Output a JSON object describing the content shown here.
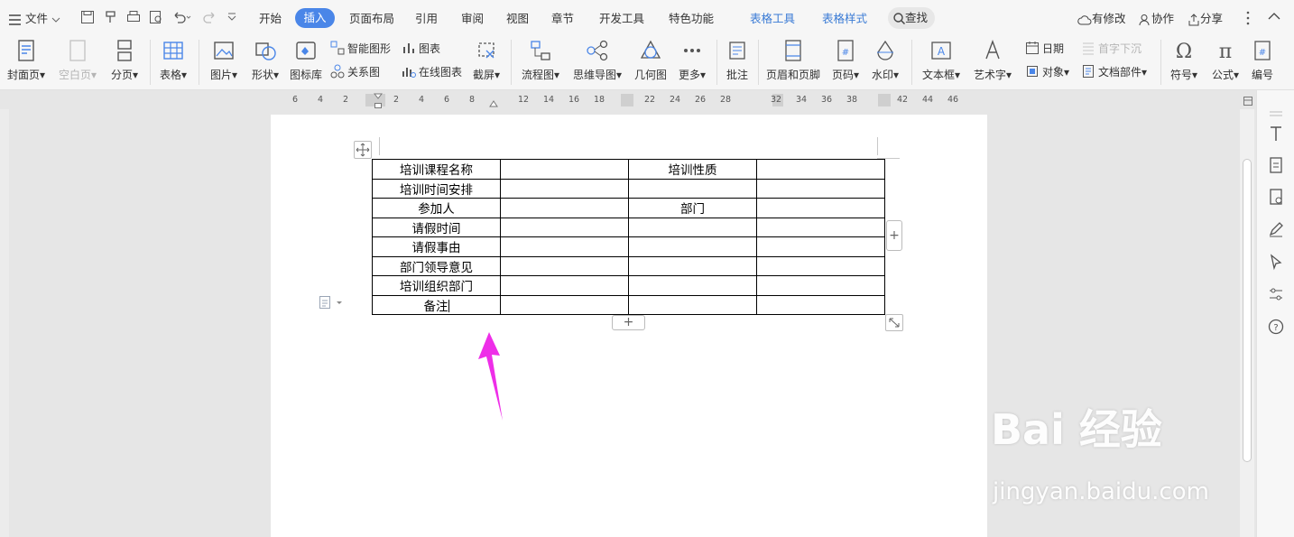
{
  "menubar": {
    "file_label": "文件",
    "tabs": [
      "开始",
      "插入",
      "页面布局",
      "引用",
      "审阅",
      "视图",
      "章节",
      "开发工具",
      "特色功能"
    ],
    "context_tabs": [
      "表格工具",
      "表格样式"
    ],
    "search_label": "查找",
    "right_items": [
      "有修改",
      "协作",
      "分享"
    ]
  },
  "ribbon": {
    "cover": "封面页",
    "blank": "空白页",
    "pagebreak": "分页",
    "table": "表格",
    "picture": "图片",
    "shape": "形状",
    "iconlib": "图标库",
    "smartart": "智能图形",
    "chart": "图表",
    "relation": "关系图",
    "onlinechart": "在线图表",
    "screenshot": "截屏",
    "flowchart": "流程图",
    "mindmap": "思维导图",
    "geometry": "几何图",
    "more": "更多",
    "comment": "批注",
    "headerfooter": "页眉和页脚",
    "pagenum": "页码",
    "watermark": "水印",
    "textbox": "文本框",
    "wordart": "艺术字",
    "date": "日期",
    "dropcap": "首字下沉",
    "object": "对象",
    "docparts": "文档部件",
    "symbol": "符号",
    "formula": "公式",
    "numbering": "编号"
  },
  "ruler": {
    "numbers": [
      "6",
      "4",
      "2",
      "2",
      "4",
      "6",
      "8",
      "12",
      "14",
      "16",
      "18",
      "22",
      "24",
      "26",
      "28",
      "32",
      "34",
      "36",
      "38",
      "42",
      "44",
      "46"
    ]
  },
  "table": {
    "rows": [
      [
        "培训课程名称",
        "",
        "培训性质",
        ""
      ],
      [
        "培训时间安排",
        "",
        "",
        ""
      ],
      [
        "参加人",
        "",
        "部门",
        ""
      ],
      [
        "请假时间",
        "",
        "",
        ""
      ],
      [
        "请假事由",
        "",
        "",
        ""
      ],
      [
        "部门领导意见",
        "",
        "",
        ""
      ],
      [
        "培训组织部门",
        "",
        "",
        ""
      ],
      [
        "备注",
        "",
        "",
        ""
      ]
    ]
  },
  "table_controls": {
    "add_column": "+",
    "add_row": "+"
  },
  "watermark": {
    "brand": "Bai 经验",
    "url": "jingyan.baidu.com"
  },
  "colors": {
    "accent": "#4a86e8",
    "arrow": "#ee2ee8",
    "context_tab": "#3a7bd5"
  }
}
